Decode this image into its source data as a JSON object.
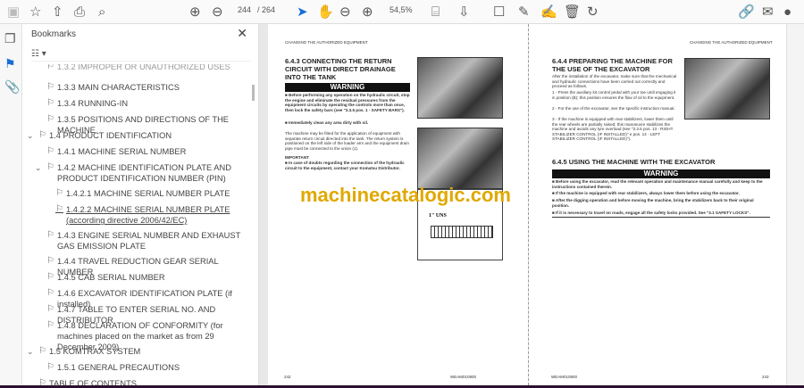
{
  "toolbar": {
    "page_current": "244",
    "page_total": "/ 264",
    "zoom": "54,5%"
  },
  "bookmarks": {
    "title": "Bookmarks",
    "items": [
      {
        "label": "1.3.2 IMPROPER OR UNAUTHORIZED USES"
      },
      {
        "label": "1.3.3 MAIN CHARACTERISTICS"
      },
      {
        "label": "1.3.4 RUNNING-IN"
      },
      {
        "label": "1.3.5 POSITIONS AND DIRECTIONS OF THE MACHINE"
      },
      {
        "label": "1.4 PRODUCT IDENTIFICATION"
      },
      {
        "label": "1.4.1 MACHINE SERIAL NUMBER"
      },
      {
        "label": "1.4.2 MACHINE IDENTIFICATION PLATE AND PRODUCT IDENTIFICATION NUMBER (PIN)"
      },
      {
        "label": "1.4.2.1 MACHINE SERIAL NUMBER PLATE"
      },
      {
        "label": "1.4.2.2 MACHINE SERIAL NUMBER PLATE (according directive 2006/42/EC)"
      },
      {
        "label": "1.4.3 ENGINE SERIAL NUMBER AND EXHAUST GAS EMISSION PLATE"
      },
      {
        "label": "1.4.4 TRAVEL REDUCTION GEAR SERIAL NUMBER"
      },
      {
        "label": "1.4.5 CAB SERIAL NUMBER"
      },
      {
        "label": "1.4.6 EXCAVATOR IDENTIFICATION PLATE (if installed)"
      },
      {
        "label": "1.4.7 TABLE TO ENTER SERIAL NO. AND DISTRIBUTOR"
      },
      {
        "label": "1.4.8 DECLARATION OF CONFORMITY (for machines placed on the market as from 29 December 2009)"
      },
      {
        "label": "1.5 KOMTRAX SYSTEM"
      },
      {
        "label": "1.5.1 GENERAL PRECAUTIONS"
      },
      {
        "label": "TABLE OF CONTENTS"
      }
    ]
  },
  "left_page": {
    "header": "CHANGING THE AUTHORIZED EQUIPMENT",
    "title": "6.4.3  CONNECTING THE RETURN CIRCUIT WITH DIRECT DRAINAGE INTO THE TANK",
    "warning": "WARNING",
    "w1": "■ Before performing any operation on the hydraulic circuit, stop the engine and eliminate the residual pressures from the equipment circuits by operating the controls more than once, then lock the safety bars (see \"3.3.5 pos. 1 - SAFETY BARS\").",
    "w2": "■ Immediately clean any area dirty with oil.",
    "body": "The machine may be fitted for the application of equipment with separate return circuit directed into the tank. The return system is positioned on the left side of the loader arm and the equipment drain pipe must be connected to the union (1).",
    "important": "IMPORTANT",
    "imp1": "■ In case of doubts regarding the connection of the hydraulic circuit to the equipment, contact your Komatsu Distributor.",
    "diagram_label": "1\" UNS",
    "page_no": "242",
    "code": "WEAM010800"
  },
  "right_page": {
    "header": "CHANGING THE AUTHORIZED EQUIPMENT",
    "title1": "6.4.4  PREPARING THE MACHINE FOR THE USE OF THE EXCAVATOR",
    "intro": "After the installation of the excavator, make sure that the mechanical and hydraulic connections have been carried out correctly and proceed as follows.",
    "s1": "1 - Press the auxiliary kit control pedal with your toe until engaging it in position (B); this position ensures the flow of oil to the equipment.",
    "s2": "2 - For the use of the excavator, see the specific instruction manual.",
    "s3": "3 - If the machine is equipped with rear stabilizers, lower them until the rear wheels are partially raised; this manoeuvre stabilizes the machine and avoids any tyre overload (see \"3.3.5 pos. 13 - RIGHT STABILIZER CONTROL (IF INSTALLED)\" e pos. 14 - LEFT STABILIZER CONTROL (IF INSTALLED)\").",
    "title2": "6.4.5  USING THE MACHINE WITH THE EXCAVATOR",
    "warning": "WARNING",
    "w1": "■ Before using the excavator, read the relevant operation and maintenance manual carefully and keep to the instructions contained therein.",
    "w2": "■ If the machine is equipped with rear stabilizers, always lower them before using the excavator.",
    "w3": "■ After the digging operation and before moving the machine, bring the stabilizers back to their original position.",
    "w4": "■ If it is necessary to travel on roads, engage all the safety locks provided. See \"3.1 SAFETY LOCKS\".",
    "page_no": "243",
    "code": "WEAM010800"
  },
  "watermark": "machinecatalogic.com"
}
